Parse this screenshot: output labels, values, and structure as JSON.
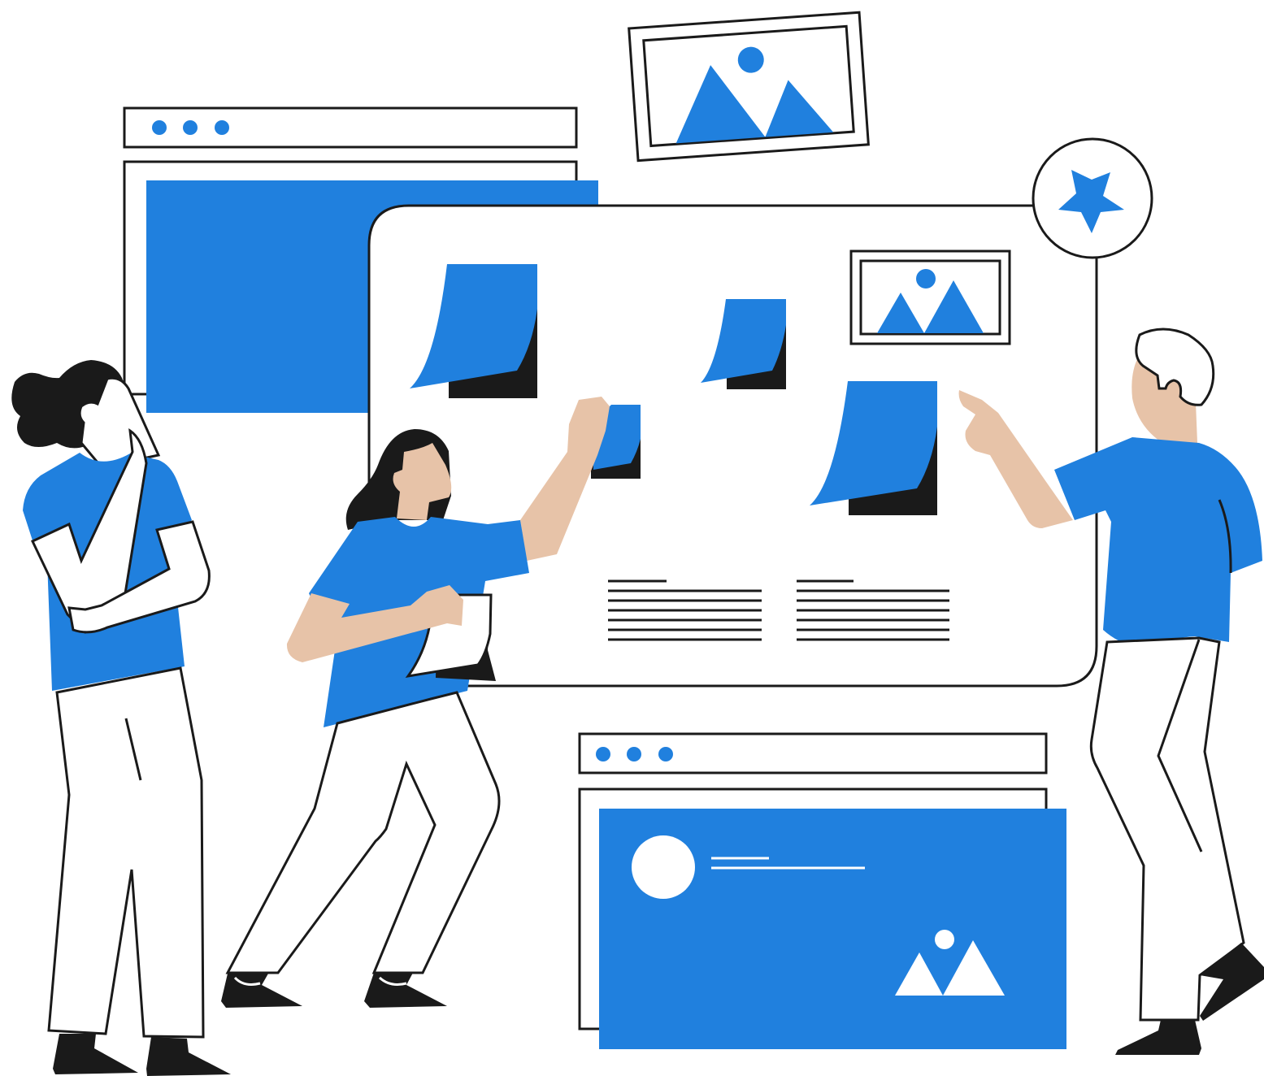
{
  "colors": {
    "accent": "#2080de",
    "ink": "#1a1a1a",
    "skin": "#e7c3a8",
    "paper": "#ffffff"
  },
  "icons": {
    "window_dots": "three-dots-icon",
    "image": "mountain-image-icon",
    "star": "star-icon",
    "avatar": "avatar-circle-icon"
  }
}
